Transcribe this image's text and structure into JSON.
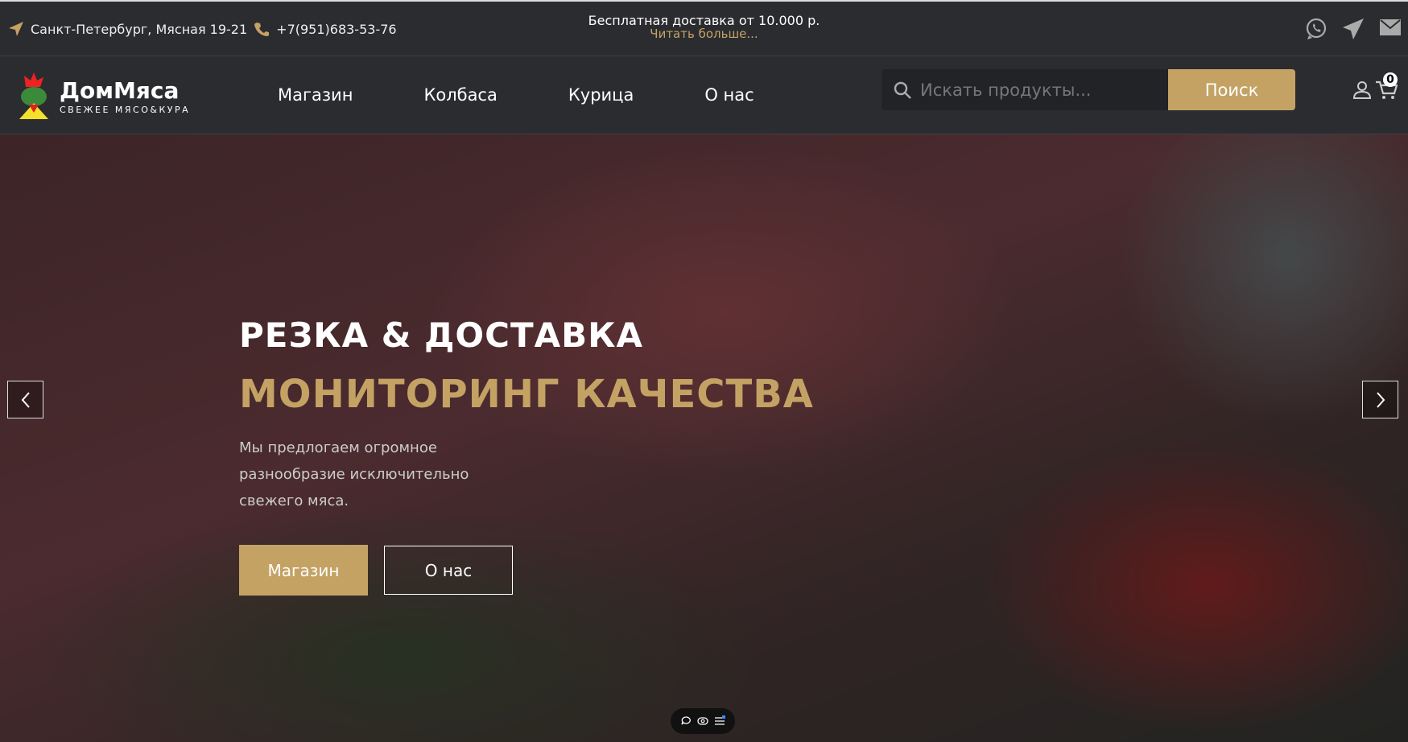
{
  "topbar": {
    "address": "Санкт-Петербург, Мясная 19-21",
    "phone": "+7(951)683-53-76",
    "promo": "Бесплатная доставка от 10.000 р.",
    "promo_link": "Читать больше..."
  },
  "brand": {
    "name": "ДомМяса",
    "tagline": "СВЕЖЕЕ МЯСО&КУРА"
  },
  "nav": [
    "Магазин",
    "Колбаса",
    "Курица",
    "О нас"
  ],
  "search": {
    "placeholder": "Искать продукты...",
    "button": "Поиск"
  },
  "cart": {
    "count": "0"
  },
  "hero": {
    "title": "РЕЗКА & ДОСТАВКА",
    "subtitle": "МОНИТОРИНГ КАЧЕСТВА",
    "description": "Мы предлогаем огромное разнообразие исключительно свежего мяса.",
    "primary_button": "Магазин",
    "secondary_button": "О нас"
  },
  "colors": {
    "accent": "#c4a264",
    "background": "#2b2c30"
  }
}
